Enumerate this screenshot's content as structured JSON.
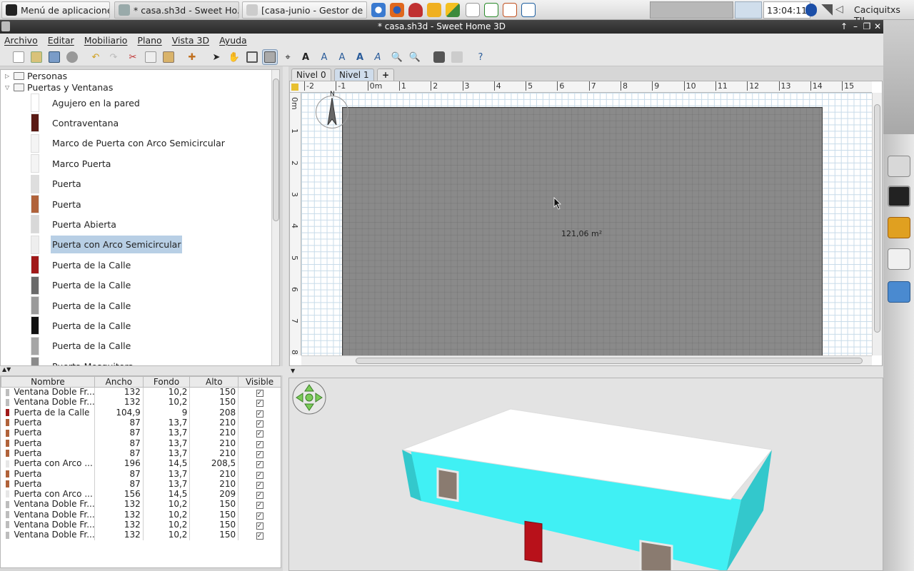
{
  "taskbar": {
    "apps_menu": "Menú de aplicaciones",
    "windows": [
      "* casa.sh3d - Sweet Ho...",
      "[casa-junio - Gestor de ..."
    ],
    "clock": "13:04:11",
    "user": "Caciquitxs TIL"
  },
  "window": {
    "title": "* casa.sh3d - Sweet Home 3D"
  },
  "menu": [
    "Archivo",
    "Editar",
    "Mobiliario",
    "Plano",
    "Vista 3D",
    "Ayuda"
  ],
  "catalog": {
    "categories": [
      "Personas",
      "Puertas y Ventanas"
    ],
    "items": [
      {
        "label": "Agujero en la pared",
        "color": "#ffffff"
      },
      {
        "label": "Contraventana",
        "color": "#5a1a14"
      },
      {
        "label": "Marco de Puerta con Arco Semicircular",
        "color": "#f4f4f4"
      },
      {
        "label": "Marco Puerta",
        "color": "#f4f4f4"
      },
      {
        "label": "Puerta",
        "color": "#dedede"
      },
      {
        "label": "Puerta",
        "color": "#b0623a"
      },
      {
        "label": "Puerta Abierta",
        "color": "#d8d8d8"
      },
      {
        "label": "Puerta con Arco Semicircular",
        "color": "#eeeeee"
      },
      {
        "label": "Puerta de la Calle",
        "color": "#a01818"
      },
      {
        "label": "Puerta de la Calle",
        "color": "#6a6a6a"
      },
      {
        "label": "Puerta de la Calle",
        "color": "#9a9a9a"
      },
      {
        "label": "Puerta de la Calle",
        "color": "#111111"
      },
      {
        "label": "Puerta de la Calle",
        "color": "#a5a5a5"
      },
      {
        "label": "Puerta Mosquitera",
        "color": "#8a8a8a"
      }
    ],
    "selected_index": 7
  },
  "furniture_table": {
    "headers": [
      "Nombre",
      "Ancho",
      "Fondo",
      "Alto",
      "Visible"
    ],
    "rows": [
      {
        "name": "Ventana Doble Fr...",
        "w": "132",
        "d": "10,2",
        "h": "150",
        "c": "#bdbdbd"
      },
      {
        "name": "Ventana Doble Fr...",
        "w": "132",
        "d": "10,2",
        "h": "150",
        "c": "#bdbdbd"
      },
      {
        "name": "Puerta de la Calle",
        "w": "104,9",
        "d": "9",
        "h": "208",
        "c": "#a01818"
      },
      {
        "name": "Puerta",
        "w": "87",
        "d": "13,7",
        "h": "210",
        "c": "#b0623a"
      },
      {
        "name": "Puerta",
        "w": "87",
        "d": "13,7",
        "h": "210",
        "c": "#b0623a"
      },
      {
        "name": "Puerta",
        "w": "87",
        "d": "13,7",
        "h": "210",
        "c": "#b0623a"
      },
      {
        "name": "Puerta",
        "w": "87",
        "d": "13,7",
        "h": "210",
        "c": "#b0623a"
      },
      {
        "name": "Puerta con Arco ...",
        "w": "196",
        "d": "14,5",
        "h": "208,5",
        "c": "#e6e6e6"
      },
      {
        "name": "Puerta",
        "w": "87",
        "d": "13,7",
        "h": "210",
        "c": "#b0623a"
      },
      {
        "name": "Puerta",
        "w": "87",
        "d": "13,7",
        "h": "210",
        "c": "#b0623a"
      },
      {
        "name": "Puerta con Arco ...",
        "w": "156",
        "d": "14,5",
        "h": "209",
        "c": "#e6e6e6"
      },
      {
        "name": "Ventana Doble Fr...",
        "w": "132",
        "d": "10,2",
        "h": "150",
        "c": "#bdbdbd"
      },
      {
        "name": "Ventana Doble Fr...",
        "w": "132",
        "d": "10,2",
        "h": "150",
        "c": "#bdbdbd"
      },
      {
        "name": "Ventana Doble Fr...",
        "w": "132",
        "d": "10,2",
        "h": "150",
        "c": "#bdbdbd"
      },
      {
        "name": "Ventana Doble Fr...",
        "w": "132",
        "d": "10,2",
        "h": "150",
        "c": "#bdbdbd"
      }
    ]
  },
  "plan": {
    "levels": [
      "Nivel 0",
      "Nivel 1"
    ],
    "active_level": "Nivel 1",
    "add_level": "+",
    "ruler_h": [
      "-2",
      "-1",
      "0m",
      "1",
      "2",
      "3",
      "4",
      "5",
      "6",
      "7",
      "8",
      "9",
      "10",
      "11",
      "12",
      "13",
      "14",
      "15"
    ],
    "ruler_v": [
      "0m",
      "1",
      "2",
      "3",
      "4",
      "5",
      "6",
      "7",
      "8"
    ],
    "room_area": "121,06 m²",
    "compass_label": "N"
  },
  "colors": {
    "wall_3d": "#40f0f4",
    "roof_3d": "#ffffff",
    "door_3d": "#b8111a",
    "room": "#8a8a8a",
    "grid": "#c8dbe9"
  }
}
